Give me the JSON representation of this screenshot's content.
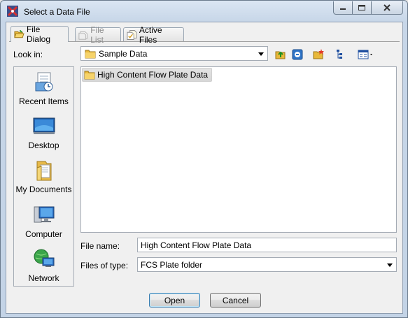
{
  "window": {
    "title": "Select a Data File"
  },
  "tabs": [
    {
      "label": "File Dialog",
      "icon": "folder-open-icon",
      "active": true
    },
    {
      "label": "File List",
      "icon": "file-list-icon",
      "active": false
    },
    {
      "label": "Active Files",
      "icon": "active-files-icon",
      "active": false
    }
  ],
  "look_in": {
    "label": "Look in:",
    "value": "Sample Data"
  },
  "toolbar": [
    "up-folder-icon",
    "desktop-icon",
    "new-folder-icon",
    "list-view-icon",
    "details-view-icon"
  ],
  "places": [
    {
      "label": "Recent Items",
      "icon": "recent-items-icon"
    },
    {
      "label": "Desktop",
      "icon": "desktop-icon"
    },
    {
      "label": "My Documents",
      "icon": "my-documents-icon"
    },
    {
      "label": "Computer",
      "icon": "computer-icon"
    },
    {
      "label": "Network",
      "icon": "network-icon"
    }
  ],
  "file_list": {
    "items": [
      {
        "name": "High Content Flow Plate Data",
        "icon": "folder-icon",
        "selected": true
      }
    ]
  },
  "file_name": {
    "label": "File name:",
    "value": "High Content Flow Plate Data"
  },
  "file_type": {
    "label": "Files of type:",
    "value": "FCS Plate folder"
  },
  "buttons": {
    "open": "Open",
    "cancel": "Cancel"
  },
  "colors": {
    "title_gradient_top": "#dbe6f3",
    "folder_yellow": "#f1c24b",
    "default_button_border": "#3c7fb1"
  }
}
